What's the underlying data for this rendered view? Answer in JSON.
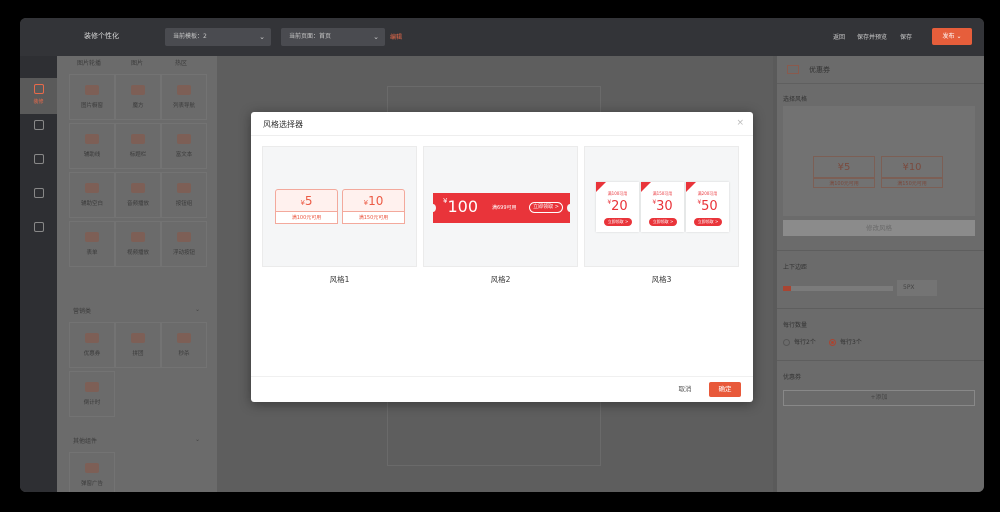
{
  "header": {
    "title": "装修个性化",
    "template_select": "当前模板：2",
    "page_select": "当前页面：首页",
    "edit_link": "编辑",
    "actions": [
      "返回",
      "保存并预览",
      "保存"
    ],
    "publish": "发布"
  },
  "rail": {
    "items": [
      "装修",
      "",
      "",
      "",
      ""
    ]
  },
  "panel": {
    "top_tabs": [
      "图片轮播",
      "图片",
      "热区"
    ],
    "basic_rows": [
      [
        "图片橱窗",
        "魔方",
        "列表导航"
      ],
      [
        "辅助线",
        "标题栏",
        "富文本"
      ],
      [
        "辅助空白",
        "音频播放",
        "按钮组"
      ],
      [
        "表单",
        "视频播放",
        "浮动按钮"
      ]
    ],
    "marketing_title": "营销类",
    "marketing": [
      "优惠券",
      "拼团",
      "秒杀",
      "倒计时"
    ],
    "other_title": "其他组件",
    "other": [
      "弹窗广告"
    ]
  },
  "props": {
    "title": "优惠券",
    "style_label": "选择风格",
    "preview": [
      {
        "amount": "5",
        "cond": "满100元可用"
      },
      {
        "amount": "10",
        "cond": "满150元可用"
      }
    ],
    "modify_btn": "修改风格",
    "spacing_label": "上下边距",
    "spacing_value": "5PX",
    "per_row_label": "每行数量",
    "per_row_options": [
      "每行2个",
      "每行3个"
    ],
    "coupon_label": "优惠券",
    "add_btn": "+添加"
  },
  "modal": {
    "title": "风格选择器",
    "close": "×",
    "styles": [
      {
        "label": "风格1",
        "coupons": [
          {
            "currency": "¥",
            "amount": "5",
            "cond": "满100元可用"
          },
          {
            "currency": "¥",
            "amount": "10",
            "cond": "满150元可用"
          }
        ]
      },
      {
        "label": "风格2",
        "coupon": {
          "currency": "¥",
          "amount": "100",
          "cond": "满699可用",
          "button": "立即领取 >"
        }
      },
      {
        "label": "风格3",
        "coupons": [
          {
            "cond": "满100可用",
            "currency": "¥",
            "amount": "20",
            "button": "立即领取 >"
          },
          {
            "cond": "满150可用",
            "currency": "¥",
            "amount": "30",
            "button": "立即领取 >"
          },
          {
            "cond": "满200可用",
            "currency": "¥",
            "amount": "50",
            "button": "立即领取 >"
          }
        ]
      }
    ],
    "cancel": "取消",
    "ok": "确定"
  },
  "colors": {
    "accent": "#e8593a",
    "coupon_red": "#e9343a",
    "topbar": "#333438"
  }
}
